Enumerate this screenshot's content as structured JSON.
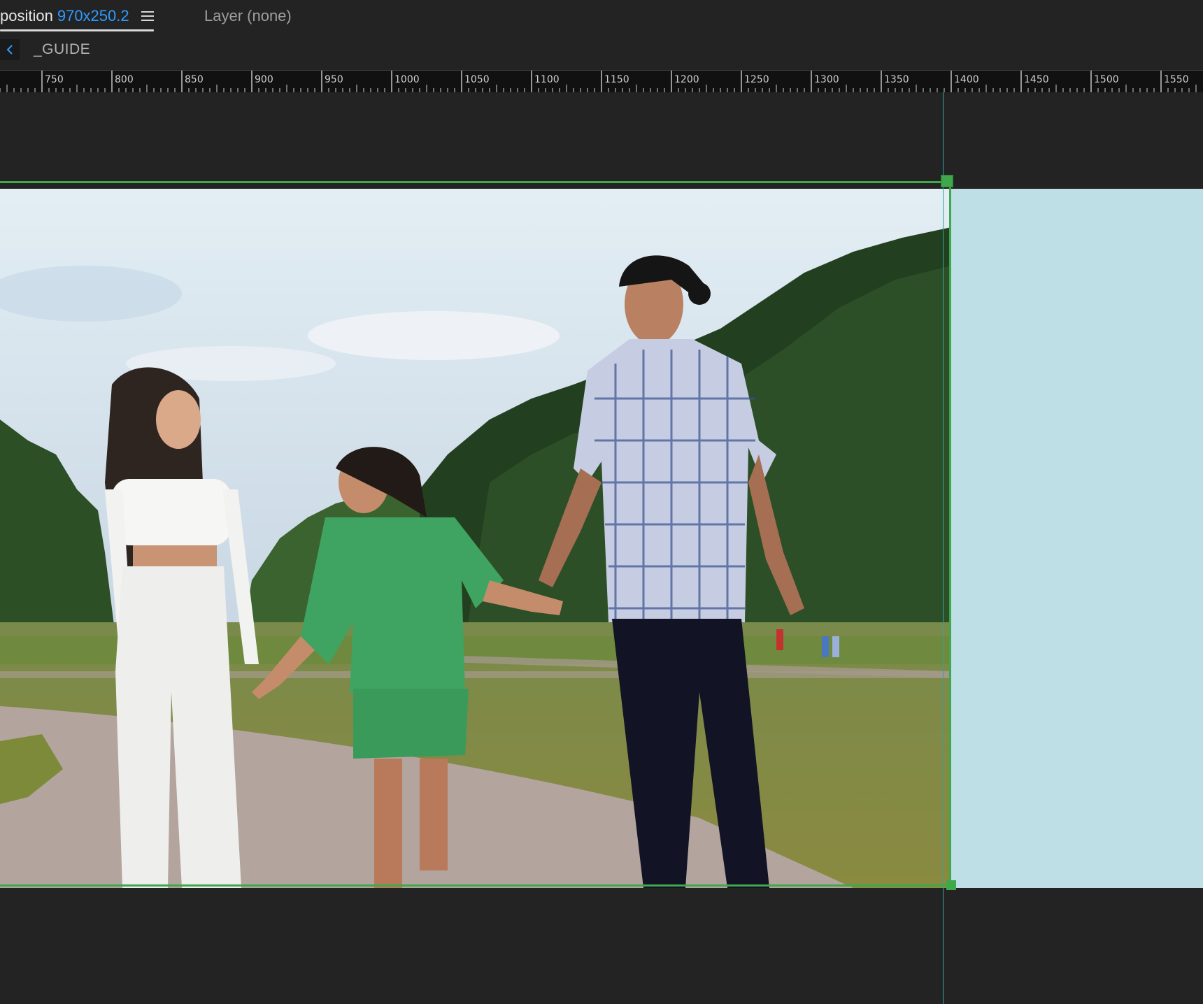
{
  "header": {
    "composition_tab_label": "position",
    "composition_size": "970x250.2",
    "layer_tab_label": "Layer (none)"
  },
  "breadcrumb": {
    "label": "_GUIDE"
  },
  "ruler": {
    "labels": [
      "750",
      "800",
      "850",
      "900",
      "950",
      "1000",
      "1050",
      "1100",
      "1150",
      "1200",
      "1250",
      "1300",
      "1350",
      "1400",
      "1450",
      "1500",
      "1550"
    ]
  },
  "colors": {
    "accent_blue": "#2f9bff",
    "guide_teal": "#2aa6a6",
    "bounds_green": "#3fa84a",
    "panel_bg": "#232323",
    "transparent_area": "#bfdfe6"
  },
  "icons": {
    "back": "chevron-left-icon",
    "panel_menu": "hamburger-menu-icon"
  }
}
